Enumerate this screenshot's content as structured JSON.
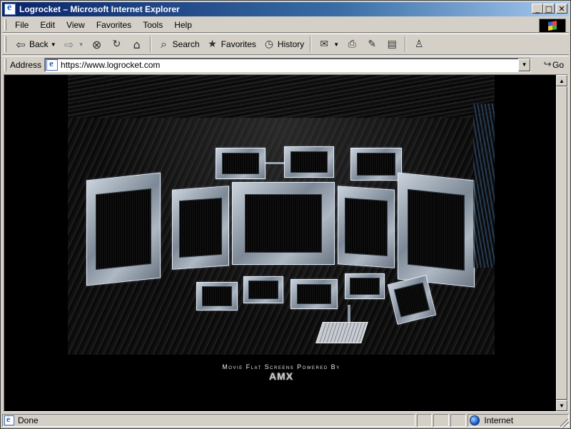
{
  "window": {
    "title": "Logrocket – Microsoft Internet Explorer"
  },
  "title_buttons": {
    "minimize": "_",
    "maximize": "□",
    "close": "✕"
  },
  "menu": [
    "File",
    "Edit",
    "View",
    "Favorites",
    "Tools",
    "Help"
  ],
  "toolbar": {
    "back_label": "Back",
    "search_label": "Search",
    "favorites_label": "Favorites",
    "history_label": "History"
  },
  "address": {
    "label": "Address",
    "url": "https://www.logrocket.com",
    "go_label": "Go"
  },
  "content": {
    "caption": "Movie Flat Screens Powered By",
    "brand": "AMX"
  },
  "status": {
    "text": "Done",
    "zone": "Internet"
  }
}
